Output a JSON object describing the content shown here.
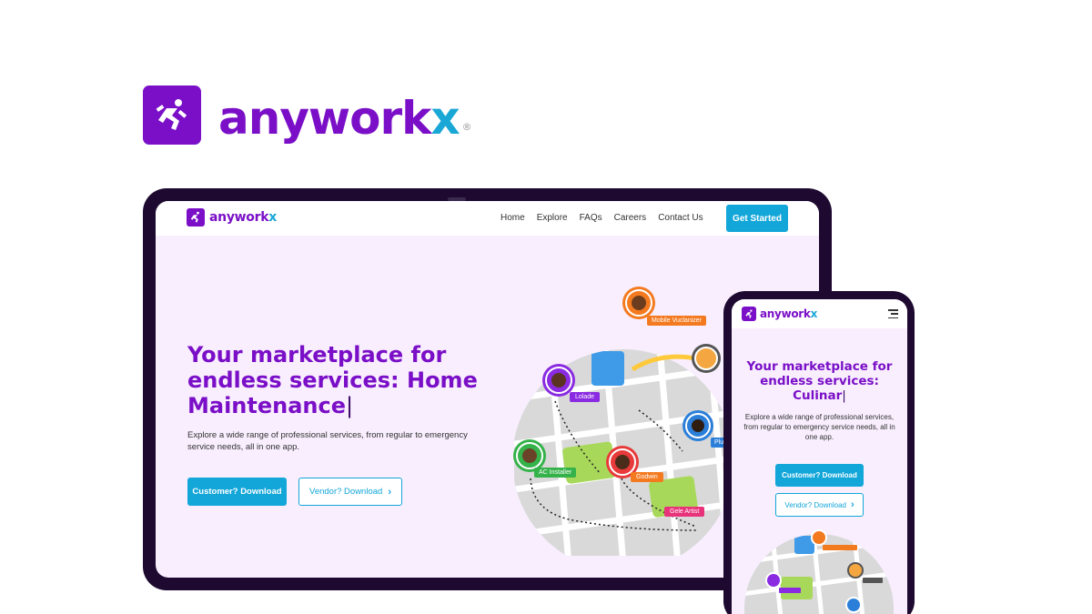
{
  "brand": {
    "name_main": "anywork",
    "name_x": "x",
    "registered_symbol": "®",
    "purple": "#7a0fc7",
    "blue": "#19a7d6",
    "device_frame": "#1e0a30"
  },
  "tablet": {
    "nav": {
      "links": [
        "Home",
        "Explore",
        "FAQs",
        "Careers",
        "Contact Us"
      ],
      "cta": "Get Started"
    },
    "hero": {
      "title": "Your marketplace for endless services: Home Maintenance",
      "caret": "|",
      "subtitle": "Explore a wide range of professional services, from regular to emergency service needs, all in one app.",
      "primary_button": "Customer? Download",
      "secondary_button": "Vendor? Download",
      "chevron_glyph": "›"
    },
    "map_pins": [
      {
        "label": "Mobile Vuclanizer",
        "color": "#f47a20"
      },
      {
        "label": "Lolade",
        "color": "#8a2be2"
      },
      {
        "label": "AC Installer",
        "color": "#35b24a"
      },
      {
        "label": "Godwin",
        "color": "#f47a20"
      },
      {
        "label": "Plum",
        "color": "#2b7fd9"
      },
      {
        "label": "Gele Artist",
        "color": "#e8327a"
      }
    ]
  },
  "phone": {
    "hero": {
      "title": "Your marketplace for endless services: Culinar",
      "caret": "|",
      "subtitle": "Explore a wide range of professional services, from regular to emergency service needs, all in one app.",
      "primary_button": "Customer? Download",
      "secondary_button": "Vendor? Download",
      "chevron_glyph": "›"
    }
  }
}
